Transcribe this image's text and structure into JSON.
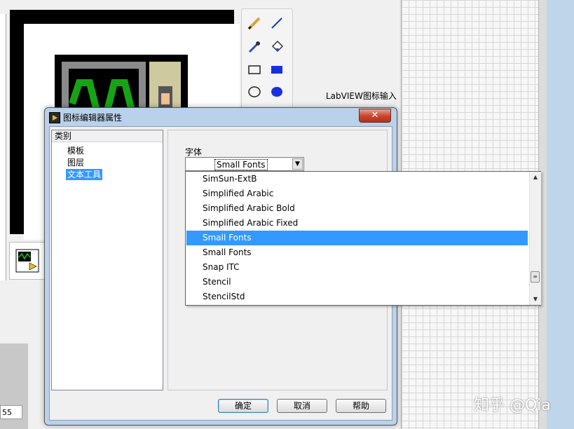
{
  "background": {
    "label": "LabVIEW图标输入",
    "bottom_field_value": "55"
  },
  "dialog": {
    "title": "图标编辑器属性",
    "close_label": "✕",
    "category": {
      "header": "类别",
      "items": [
        {
          "label": "模板"
        },
        {
          "label": "图层"
        },
        {
          "label": "文本工具"
        }
      ],
      "selected": "文本工具"
    },
    "font": {
      "label": "字体",
      "selected_value": "Small Fonts",
      "options": [
        {
          "label": "SimSun-ExtB"
        },
        {
          "label": "Simplified Arabic"
        },
        {
          "label": "Simplified Arabic Bold"
        },
        {
          "label": "Simplified Arabic Fixed"
        },
        {
          "label": "Small Fonts"
        },
        {
          "label": "Small Fonts"
        },
        {
          "label": "Snap ITC"
        },
        {
          "label": "Stencil"
        },
        {
          "label": "StencilStd"
        }
      ],
      "highlighted_index": 4
    },
    "buttons": {
      "ok": "确定",
      "cancel": "取消",
      "help": "帮助"
    }
  },
  "watermark": "知乎 @Qia",
  "colors": {
    "selection": "#3399ff",
    "titlebar": "#b9d1ea",
    "close": "#c7432a"
  }
}
